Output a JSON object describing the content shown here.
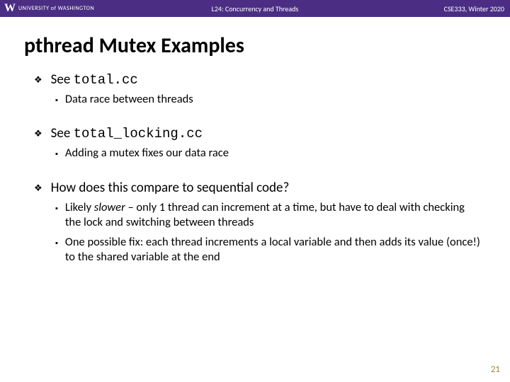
{
  "header": {
    "university": "UNIVERSITY of WASHINGTON",
    "lecture": "L24: Concurrency and Threads",
    "course": "CSE333, Winter 2020"
  },
  "title": "pthread Mutex Examples",
  "bullets": [
    {
      "prefix": "See ",
      "code": "total.cc",
      "sub": [
        {
          "text": "Data race between threads"
        }
      ]
    },
    {
      "prefix": "See ",
      "code": "total_locking.cc",
      "sub": [
        {
          "text": "Adding a mutex fixes our data race"
        }
      ]
    },
    {
      "prefix": "How does this compare to sequential code?",
      "code": "",
      "sub": [
        {
          "text_pre": "Likely ",
          "italic": "slower",
          "text_post": " – only 1 thread can increment at a time, but have to deal with checking the lock and switching between threads"
        },
        {
          "text": "One possible fix:  each thread increments a local variable and then adds its value (once!) to the shared variable at the end"
        }
      ]
    }
  ],
  "slide_number": "21"
}
